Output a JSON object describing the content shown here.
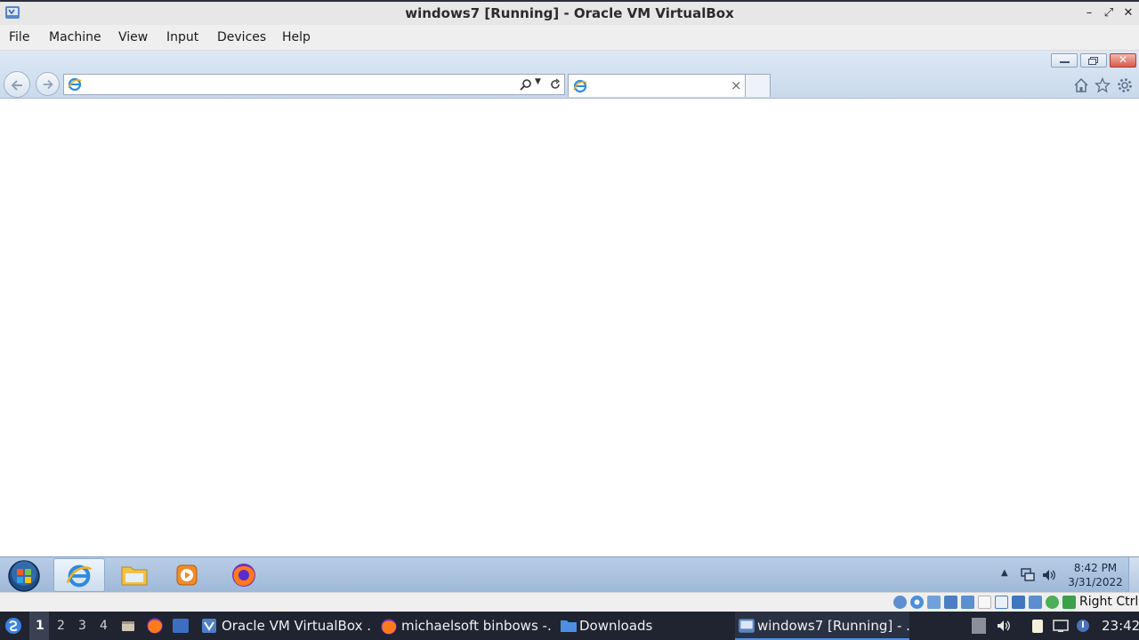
{
  "window": {
    "title": "windows7 [Running] - Oracle VM VirtualBox",
    "controls": [
      "minimize",
      "maximize",
      "close"
    ]
  },
  "menubar": {
    "items": [
      "File",
      "Machine",
      "View",
      "Input",
      "Devices",
      "Help"
    ]
  },
  "browser": {
    "address_value": "",
    "tab_title": "",
    "tab_close": "×"
  },
  "win_taskbar": {
    "pinned": [
      "Internet Explorer",
      "Windows Explorer",
      "Windows Media Player",
      "Firefox"
    ],
    "clock_time": "8:42 PM",
    "clock_date": "3/31/2022"
  },
  "vbox_status": {
    "host_key": "Right Ctrl"
  },
  "host_panel": {
    "workspaces": [
      "1",
      "2",
      "3",
      "4"
    ],
    "current_workspace": "1",
    "tasks": [
      {
        "label": "Oracle VM VirtualBox ...",
        "icon": "virtualbox-icon"
      },
      {
        "label": "michaelsoft binbows -...",
        "icon": "firefox-icon"
      },
      {
        "label": "Downloads",
        "icon": "folder-icon"
      },
      {
        "label": "windows7 [Running] - ...",
        "icon": "virtualbox-vm-icon"
      }
    ],
    "clock": "23:42"
  }
}
